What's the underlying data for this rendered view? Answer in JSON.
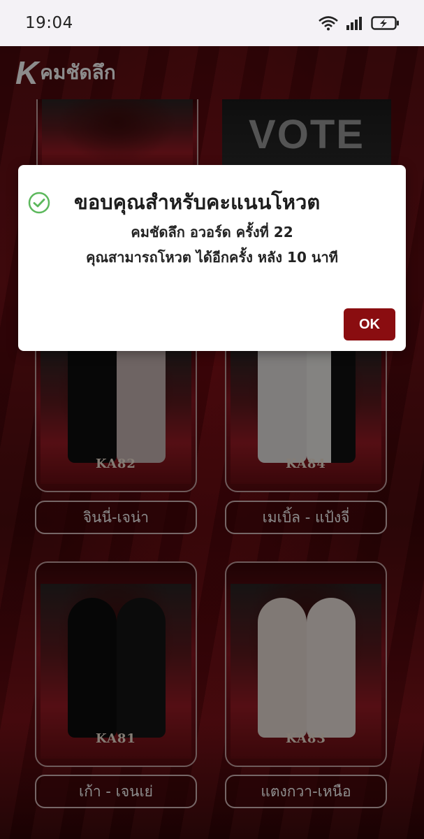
{
  "status_bar": {
    "time": "19:04",
    "icons": [
      "wifi-icon",
      "signal-icon",
      "battery-charging-icon"
    ]
  },
  "header": {
    "logo_mark": "K",
    "logo_text": "คมชัดลึก"
  },
  "vote_tile": {
    "text": "VOTE"
  },
  "cards": [
    {
      "code": "KA82",
      "name": "จินนี่-เจน่า"
    },
    {
      "code": "KA84",
      "name": "เมเบิ้ล - แป้งจี่"
    },
    {
      "code": "KA81",
      "name": "เก้า - เจนเย่"
    },
    {
      "code": "KA83",
      "name": "แตงกวา-เหนือ"
    }
  ],
  "dialog": {
    "icon": "check-circle-icon",
    "title": "ขอบคุณสำหรับคะแนนโหวต",
    "line1": "คมชัดลึก อวอร์ด ครั้งที่ 22",
    "line2": "คุณสามารถโหวต ได้อีกครั้ง หลัง 10 นาที",
    "ok_label": "OK"
  },
  "colors": {
    "accent": "#8a0d10",
    "success": "#5cb85c",
    "background": "#5a0a0e"
  }
}
